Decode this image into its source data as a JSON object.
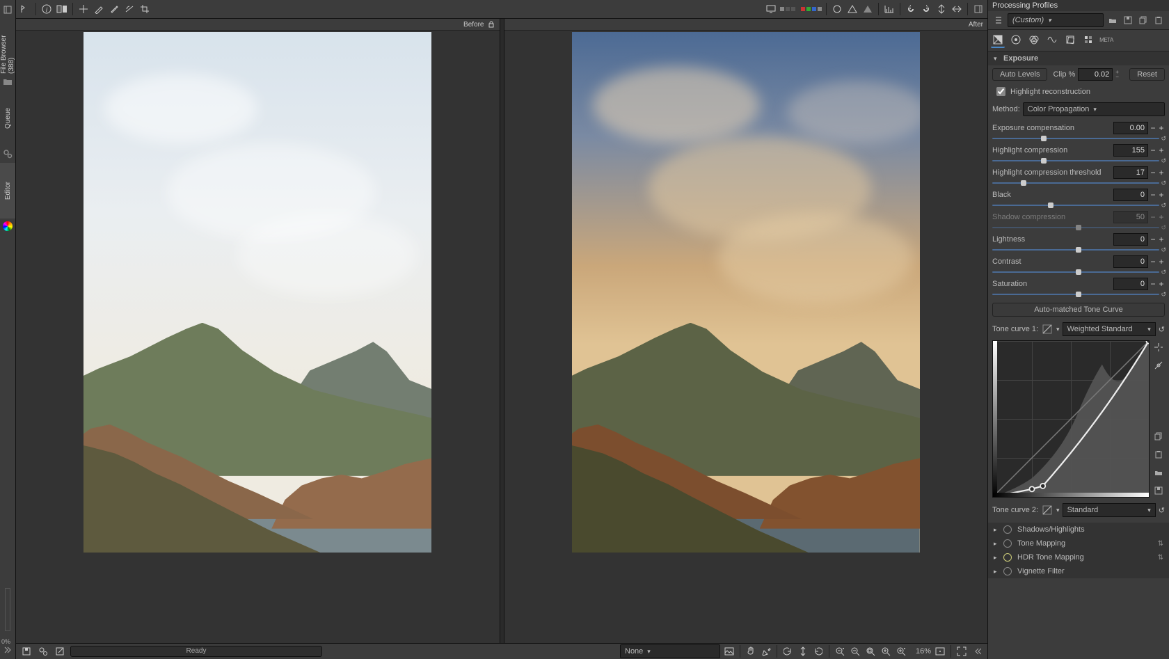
{
  "vtabs": {
    "file_browser": "File Browser (388)",
    "queue": "Queue",
    "editor": "Editor"
  },
  "bottom_pct": "0%",
  "viewer": {
    "before": "Before",
    "after": "After",
    "status": "Ready",
    "nav_mode": "None",
    "zoom": "16%"
  },
  "rpanel": {
    "title": "Processing Profiles",
    "profile": "(Custom)",
    "exposure": {
      "title": "Exposure",
      "auto_levels": "Auto Levels",
      "clip_label": "Clip %",
      "clip_value": "0.02",
      "reset": "Reset",
      "hl_recon": "Highlight reconstruction",
      "method_label": "Method:",
      "method_value": "Color Propagation",
      "params": {
        "exp_comp": {
          "label": "Exposure compensation",
          "value": "0.00",
          "pos": 30
        },
        "hl_comp": {
          "label": "Highlight compression",
          "value": "155",
          "pos": 30
        },
        "hl_thresh": {
          "label": "Highlight compression threshold",
          "value": "17",
          "pos": 18
        },
        "black": {
          "label": "Black",
          "value": "0",
          "pos": 34
        },
        "shadow": {
          "label": "Shadow compression",
          "value": "50",
          "pos": 50
        },
        "lightness": {
          "label": "Lightness",
          "value": "0",
          "pos": 50
        },
        "contrast": {
          "label": "Contrast",
          "value": "0",
          "pos": 50
        },
        "saturation": {
          "label": "Saturation",
          "value": "0",
          "pos": 50
        }
      },
      "auto_curve": "Auto-matched Tone Curve",
      "tc1_label": "Tone curve 1:",
      "tc1_value": "Weighted Standard",
      "tc2_label": "Tone curve 2:",
      "tc2_value": "Standard"
    },
    "sections": {
      "shadows": "Shadows/Highlights",
      "tone_mapping": "Tone Mapping",
      "hdr": "HDR Tone Mapping",
      "vignette": "Vignette Filter"
    }
  }
}
